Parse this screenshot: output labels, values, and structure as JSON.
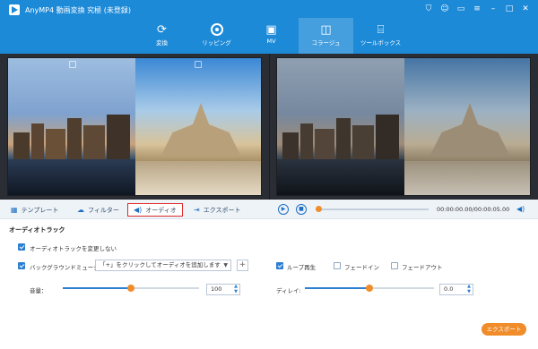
{
  "window": {
    "title": "AnyMP4 動画変換 究極 (未登録)",
    "controls": [
      "cart-icon",
      "user-icon",
      "chat-icon",
      "menu-icon",
      "minimize-icon",
      "maximize-icon",
      "close-icon"
    ]
  },
  "nav": {
    "tabs": [
      {
        "label": "変換",
        "icon": "convert-icon"
      },
      {
        "label": "リッピング",
        "icon": "rip-icon"
      },
      {
        "label": "MV",
        "icon": "mv-icon"
      },
      {
        "label": "コラージュ",
        "icon": "collage-icon",
        "active": true
      },
      {
        "label": "ツールボックス",
        "icon": "toolbox-icon"
      }
    ]
  },
  "toolbar": {
    "template_label": "テンプレート",
    "filter_label": "フィルター",
    "audio_label": "オーディオ",
    "export_label": "エクスポート",
    "time": "00:00:00.00/00:00:05.00"
  },
  "audio": {
    "section_title": "オーディオトラック",
    "keep_original_label": "オーディオトラックを変更しない",
    "bgm_label": "バックグラウンドミュージック",
    "bgm_placeholder": "「+」をクリックしてオーディオを追加します",
    "loop_label": "ループ再生",
    "fade_in_label": "フェードイン",
    "fade_out_label": "フェードアウト",
    "volume_label": "音量：",
    "volume_value": "100",
    "volume_level": 0.5,
    "delay_label": "ディレイ:",
    "delay_value": "0.0",
    "delay_level": 0.5
  },
  "export_button": "エクスポート",
  "colors": {
    "header": "#1d8ad8",
    "accent": "#f08c2a",
    "highlight_border": "#e02b2b"
  }
}
